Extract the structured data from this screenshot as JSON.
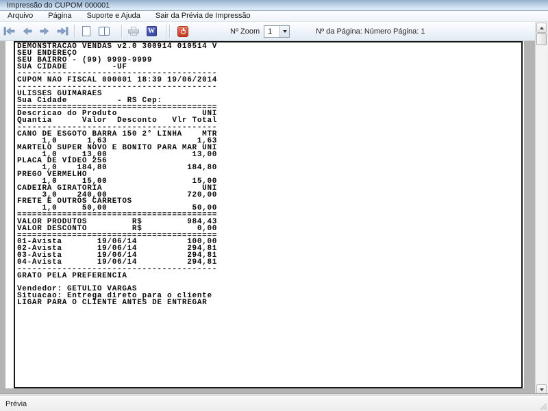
{
  "window": {
    "title": "Impressão do CUPOM 000001"
  },
  "menu": {
    "items": [
      "Arquivo",
      "Página",
      "Suporte e Ajuda",
      "Sair da Prévia de Impressão"
    ]
  },
  "toolbar": {
    "icons": [
      "first-page-icon",
      "previous-page-icon",
      "next-page-icon",
      "last-page-icon",
      "single-page-icon",
      "two-pages-icon",
      "print-icon",
      "export-word-icon",
      "exit-preview-icon"
    ],
    "word_icon_glyph": "W",
    "zoom_label": "Nº Zoom",
    "zoom_value": "1",
    "page_info": "Nº da Página: Número Página: 1"
  },
  "colors": {
    "titlebar_blue": "#b6cde5",
    "preview_gray": "#b4b4b4",
    "exit_icon_red": "#c43a22",
    "word_icon_blue": "#36459e",
    "arrow_blue": "#8ba3c7"
  },
  "receipt": {
    "lines": [
      "DEMONSTRACAO VENDAS v2.0 300914 010514 V",
      "SEU ENDEREÇO",
      "SEU BAIRRO - (99) 9999-9999",
      "SUA CIDADE         -UF",
      "----------------------------------------",
      "CUPOM NAO FISCAL 000001 18:39 19/06/2014",
      "----------------------------------------",
      "ULISSES GUIMARAES",
      "Sua Cidade          - RS Cep:",
      "========================================",
      "Descricao do Produto                 UNI",
      "Quantia      Valor  Desconto   Vlr Total",
      "----------------------------------------",
      "CANO DE ESGOTO BARRA 150 2° LINHA    MTR",
      "     1,0      1,63                  1,63",
      "MARTELO SUPER NOVO E BONITO PARA MAR UNI",
      "     1,0     13,00                 13,00",
      "PLACA DE VÍDEO 256",
      "     1,0    184,80                184,80",
      "PREGO VERMELHO",
      "     1,0     15,00                 15,00",
      "CADEIRA GIRATORIA                    UNI",
      "     3,0    240,00                720,00",
      "FRETE E OUTROS CARRETOS",
      "     1,0     50,00                 50,00",
      "========================================",
      "VALOR PRODUTOS         R$         984,43",
      "VALOR DESCONTO         R$           0,00",
      "========================================",
      "01-Avista       19/06/14          100,00",
      "02-Avista       19/06/14          294,81",
      "03-Avista       19/06/14          294,81",
      "04-Avista       19/06/14          294,81",
      "----------------------------------------",
      "GRATO PELA PREFERENCIA",
      "",
      "Vendedor: GETULIO VARGAS",
      "Situacao: Entrega direto para o cliente",
      "LIGAR PARA O CLIENTE ANTES DE ENTREGAR"
    ]
  },
  "statusbar": {
    "text": "Prévia"
  }
}
